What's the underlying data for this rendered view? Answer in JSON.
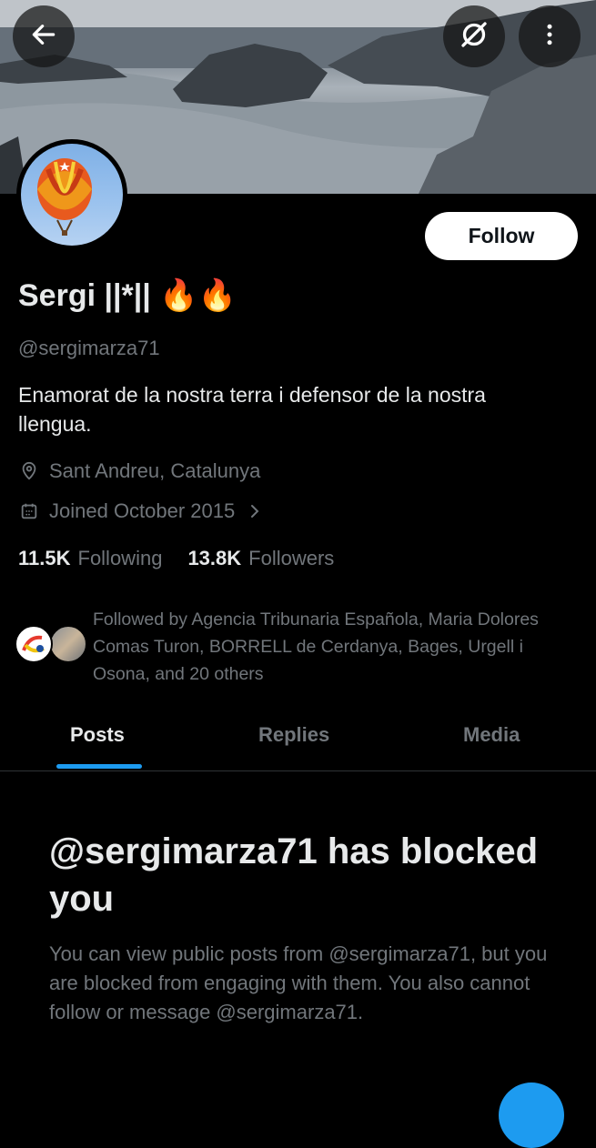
{
  "header": {
    "back_icon": "arrow-left-icon",
    "grok_icon": "grok-slash-circle-icon",
    "more_icon": "more-vertical-icon"
  },
  "profile": {
    "display_name": "Sergi ||*|| 🔥🔥",
    "handle": "@sergimarza71",
    "bio": "Enamorat de la nostra terra i defensor de la nostra llengua.",
    "location": "Sant Andreu, Catalunya",
    "joined": "Joined October 2015",
    "follow_label": "Follow"
  },
  "stats": {
    "following_count": "11.5K",
    "following_label": "Following",
    "followers_count": "13.8K",
    "followers_label": "Followers"
  },
  "followed_by": {
    "text": "Followed by Agencia Tribunaria Española, Maria Dolores Comas Turon, BORRELL de Cerdanya, Bages, Urgell i Osona, and 20 others"
  },
  "tabs": [
    {
      "label": "Posts",
      "active": true
    },
    {
      "label": "Replies",
      "active": false
    },
    {
      "label": "Media",
      "active": false
    }
  ],
  "blocked": {
    "title": "@sergimarza71 has blocked you",
    "body": "You can view public posts from @sergimarza71, but you are blocked from engaging with them. You also cannot follow or message @sergimarza71."
  },
  "colors": {
    "background": "#000000",
    "primary_text": "#e7e9ea",
    "secondary_text": "#71767b",
    "accent": "#1d9bf0"
  }
}
